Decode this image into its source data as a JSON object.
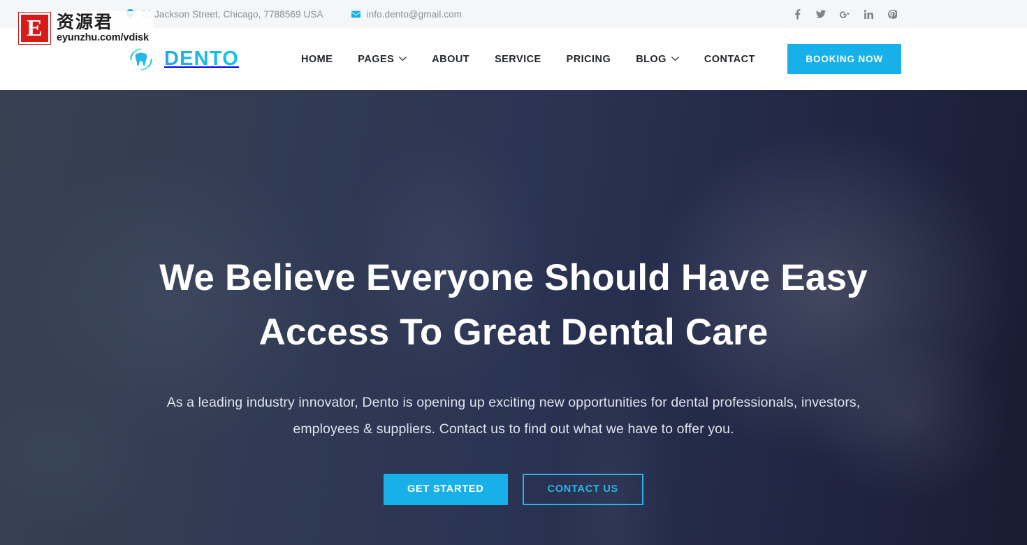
{
  "topbar": {
    "address": {
      "icon": "map-pin-icon",
      "text": "20 Jackson Street, Chicago, 7788569 USA"
    },
    "email": {
      "icon": "envelope-icon",
      "text": "info.dento@gmail.com"
    },
    "socials": [
      {
        "icon": "facebook-icon",
        "label": "Facebook"
      },
      {
        "icon": "twitter-icon",
        "label": "Twitter"
      },
      {
        "icon": "google-plus-icon",
        "label": "Google Plus"
      },
      {
        "icon": "linkedin-icon",
        "label": "LinkedIn"
      },
      {
        "icon": "pinterest-icon",
        "label": "Pinterest"
      }
    ]
  },
  "header": {
    "brand": {
      "name": "DENTO",
      "icon": "tooth-logo-icon"
    },
    "nav": [
      {
        "label": "HOME",
        "has_dropdown": false
      },
      {
        "label": "PAGES",
        "has_dropdown": true
      },
      {
        "label": "ABOUT",
        "has_dropdown": false
      },
      {
        "label": "SERVICE",
        "has_dropdown": false
      },
      {
        "label": "PRICING",
        "has_dropdown": false
      },
      {
        "label": "BLOG",
        "has_dropdown": true
      },
      {
        "label": "CONTACT",
        "has_dropdown": false
      }
    ],
    "booking_label": "BOOKING NOW"
  },
  "hero": {
    "title": "We Believe Everyone Should Have Easy Access To Great Dental Care",
    "subtitle": "As a leading industry innovator, Dento is opening up exciting new opportunities for dental professionals, investors, employees & suppliers. Contact us to find out what we have to offer you.",
    "primary_cta": "GET STARTED",
    "secondary_cta": "CONTACT US"
  },
  "watermark": {
    "badge": "E",
    "cn_text": "资源君",
    "url": "eyunzhu.com/vdisk"
  },
  "colors": {
    "accent": "#18b0e9",
    "accent_light": "#2ab3ea",
    "topbar_bg": "#f4f6f8",
    "topbar_text": "#8a8f96",
    "nav_text": "#23272b",
    "hero_text": "#ffffff",
    "watermark_red": "#d51c19"
  }
}
